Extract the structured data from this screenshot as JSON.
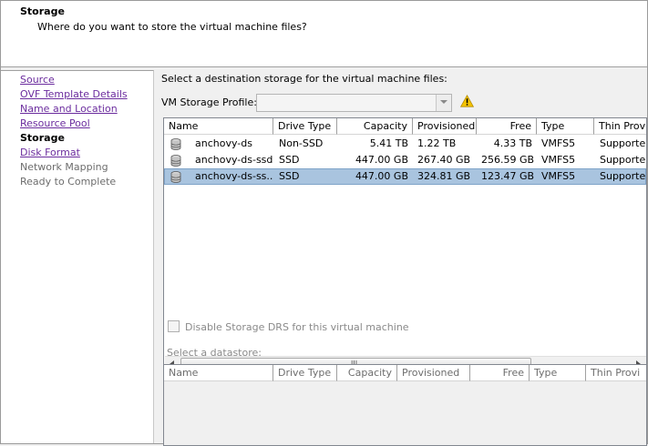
{
  "header": {
    "title": "Storage",
    "subtitle": "Where do you want to store the virtual machine files?"
  },
  "nav": {
    "items": [
      {
        "label": "Source",
        "state": "link"
      },
      {
        "label": "OVF Template Details",
        "state": "link"
      },
      {
        "label": "Name and Location",
        "state": "link"
      },
      {
        "label": "Resource Pool",
        "state": "link"
      },
      {
        "label": "Storage",
        "state": "current"
      },
      {
        "label": "Disk Format",
        "state": "link"
      },
      {
        "label": "Network Mapping",
        "state": "disabled"
      },
      {
        "label": "Ready to Complete",
        "state": "disabled"
      }
    ]
  },
  "main": {
    "instruction": "Select a destination storage for the virtual machine files:",
    "profile_label": "VM Storage Profile:",
    "profile_value": "",
    "columns": [
      "Name",
      "Drive Type",
      "Capacity",
      "Provisioned",
      "Free",
      "Type",
      "Thin Prov"
    ],
    "rows": [
      {
        "name": "anchovy-ds",
        "drive_type": "Non-SSD",
        "capacity": "5.41 TB",
        "provisioned": "1.22 TB",
        "free": "4.33 TB",
        "type": "VMFS5",
        "thin": "Supporte",
        "selected": false
      },
      {
        "name": "anchovy-ds-ssd",
        "drive_type": "SSD",
        "capacity": "447.00 GB",
        "provisioned": "267.40 GB",
        "free": "256.59 GB",
        "type": "VMFS5",
        "thin": "Supporte",
        "selected": false
      },
      {
        "name": "anchovy-ds-ss...",
        "drive_type": "SSD",
        "capacity": "447.00 GB",
        "provisioned": "324.81 GB",
        "free": "123.47 GB",
        "type": "VMFS5",
        "thin": "Supporte",
        "selected": true
      }
    ],
    "scroll_grip": "III",
    "disable_drs_label": "Disable Storage DRS for this virtual machine",
    "disable_drs_checked": false,
    "select_datastore_label": "Select a datastore:",
    "datastore_columns": [
      "Name",
      "Drive Type",
      "Capacity",
      "Provisioned",
      "Free",
      "Type",
      "Thin Provi"
    ]
  },
  "icons": {
    "warning": "warning-icon",
    "datastore": "datastore-icon"
  },
  "colors": {
    "link": "#6b2c9e",
    "selection": "#a9c4df",
    "warning": "#f5c400"
  }
}
